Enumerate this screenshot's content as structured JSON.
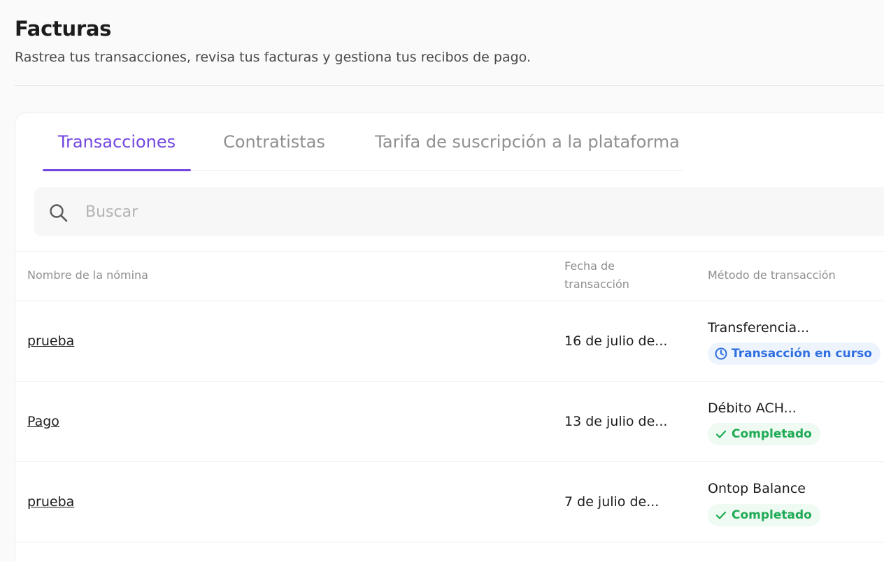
{
  "header": {
    "title": "Facturas",
    "subtitle": "Rastrea tus transacciones, revisa tus facturas y gestiona tus recibos de pago."
  },
  "tabs": [
    {
      "label": "Transacciones",
      "active": true
    },
    {
      "label": "Contratistas",
      "active": false
    },
    {
      "label": "Tarifa de suscripción a la plataforma",
      "active": false
    }
  ],
  "search": {
    "placeholder": "Buscar",
    "value": ""
  },
  "table": {
    "columns": {
      "name": "Nombre de la nómina",
      "date": "Fecha de transacción",
      "method": "Método de transacción"
    },
    "rows": [
      {
        "name": "prueba",
        "date": "16 de julio de...",
        "method": "Transferencia...",
        "status": "Transacción en curso",
        "status_icon": "clock-icon"
      },
      {
        "name": "Pago",
        "date": "13 de julio de...",
        "method": "Débito ACH...",
        "status": "Completado",
        "status_icon": "check-icon"
      },
      {
        "name": "prueba",
        "date": "7 de julio de...",
        "method": "Ontop Balance",
        "status": "Completado",
        "status_icon": "check-icon"
      }
    ]
  },
  "colors": {
    "accent": "#7447e0",
    "status_in_progress": "#2f6fe0",
    "status_completed": "#1faa55"
  }
}
